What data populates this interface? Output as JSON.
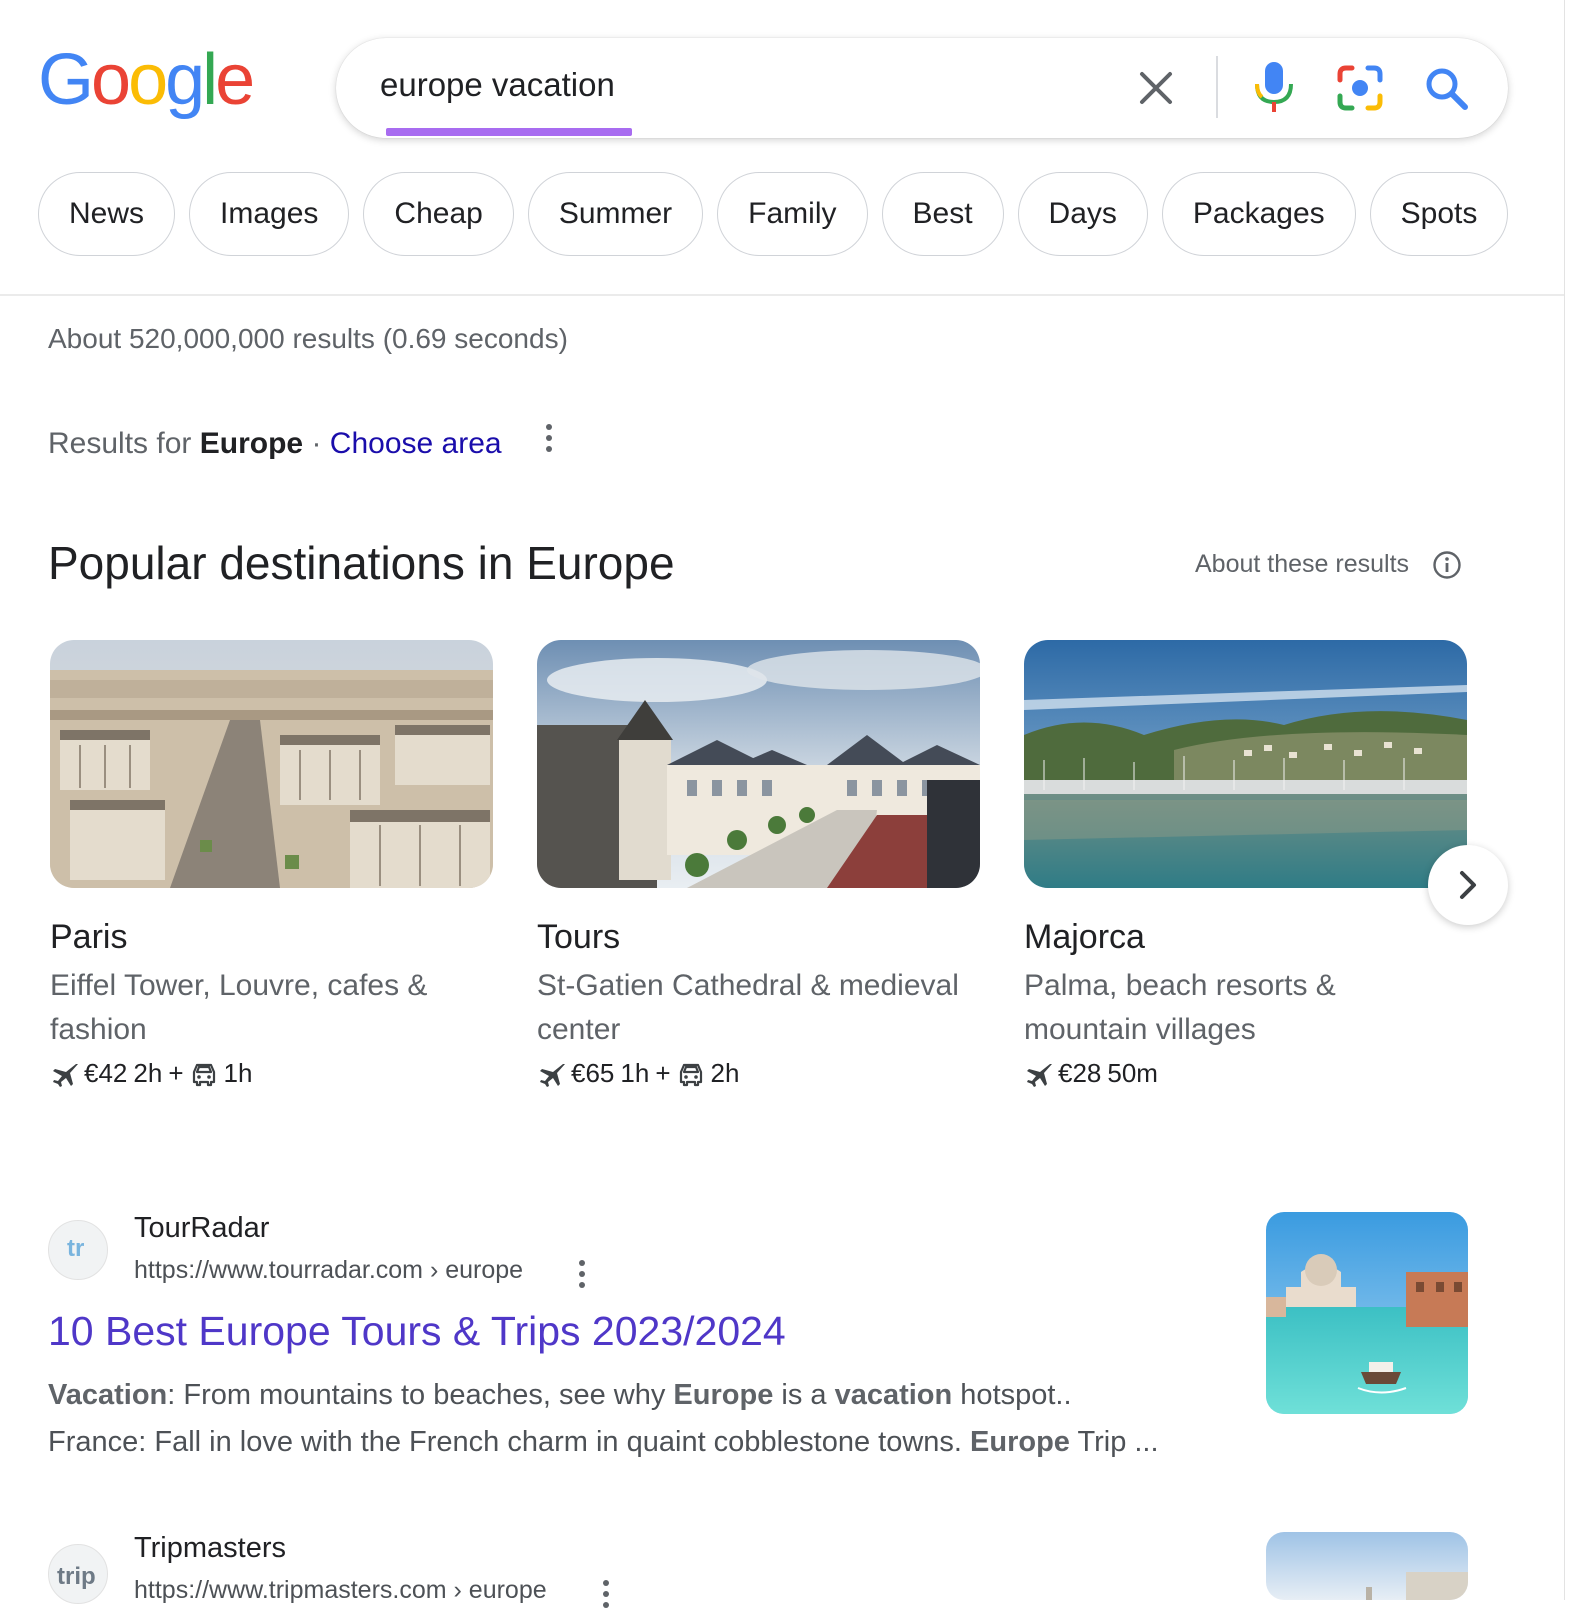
{
  "logo": {
    "text": "Google",
    "letters": [
      "G",
      "o",
      "o",
      "g",
      "l",
      "e"
    ],
    "colors": [
      "#4285F4",
      "#EA4335",
      "#FBBC05",
      "#4285F4",
      "#34A853",
      "#EA4335"
    ]
  },
  "search": {
    "query": "europe vacation",
    "accent_underline_color": "#a86cf0"
  },
  "icons": {
    "clear": "close-icon",
    "voice": "microphone-icon",
    "lens": "camera-lens-icon",
    "search": "magnifier-icon",
    "info": "info-icon",
    "more": "more-vert-icon",
    "next": "chevron-right-icon",
    "flight": "airplane-icon",
    "car": "car-icon"
  },
  "chips": [
    "News",
    "Images",
    "Cheap",
    "Summer",
    "Family",
    "Best",
    "Days",
    "Packages",
    "Spots"
  ],
  "stats": "About 520,000,000 results (0.69 seconds)",
  "region": {
    "prefix": "Results for",
    "place": "Europe",
    "separator": "·",
    "link": "Choose area"
  },
  "destinations": {
    "title": "Popular destinations in Europe",
    "about": "About these results",
    "items": [
      {
        "name": "Paris",
        "description": "Eiffel Tower, Louvre, cafes & fashion",
        "price": "€42",
        "flight": "2h",
        "plus": "+",
        "drive": "1h"
      },
      {
        "name": "Tours",
        "description": "St-Gatien Cathedral & medieval center",
        "price": "€65",
        "flight": "1h",
        "plus": "+",
        "drive": "2h"
      },
      {
        "name": "Majorca",
        "description": "Palma, beach resorts & mountain villages",
        "price": "€28",
        "flight": "50m",
        "plus": "",
        "drive": ""
      }
    ]
  },
  "results": [
    {
      "site": "TourRadar",
      "favicon_text": "tr",
      "url": "https://www.tourradar.com › europe",
      "title": "10 Best Europe Tours & Trips 2023/2024",
      "snippet_line1": [
        {
          "t": "Vacation",
          "b": true
        },
        {
          "t": ": From mountains to beaches, see why ",
          "b": false
        },
        {
          "t": "Europe",
          "b": true
        },
        {
          "t": " is a ",
          "b": false
        },
        {
          "t": "vacation",
          "b": true
        },
        {
          "t": " hotspot..",
          "b": false
        }
      ],
      "snippet_line2": [
        {
          "t": "France: Fall in love with the French charm in quaint cobblestone towns. ",
          "b": false
        },
        {
          "t": "Europe",
          "b": true
        },
        {
          "t": " Trip ...",
          "b": false
        }
      ]
    },
    {
      "site": "Tripmasters",
      "favicon_text": "trip",
      "url": "https://www.tripmasters.com › europe"
    }
  ]
}
